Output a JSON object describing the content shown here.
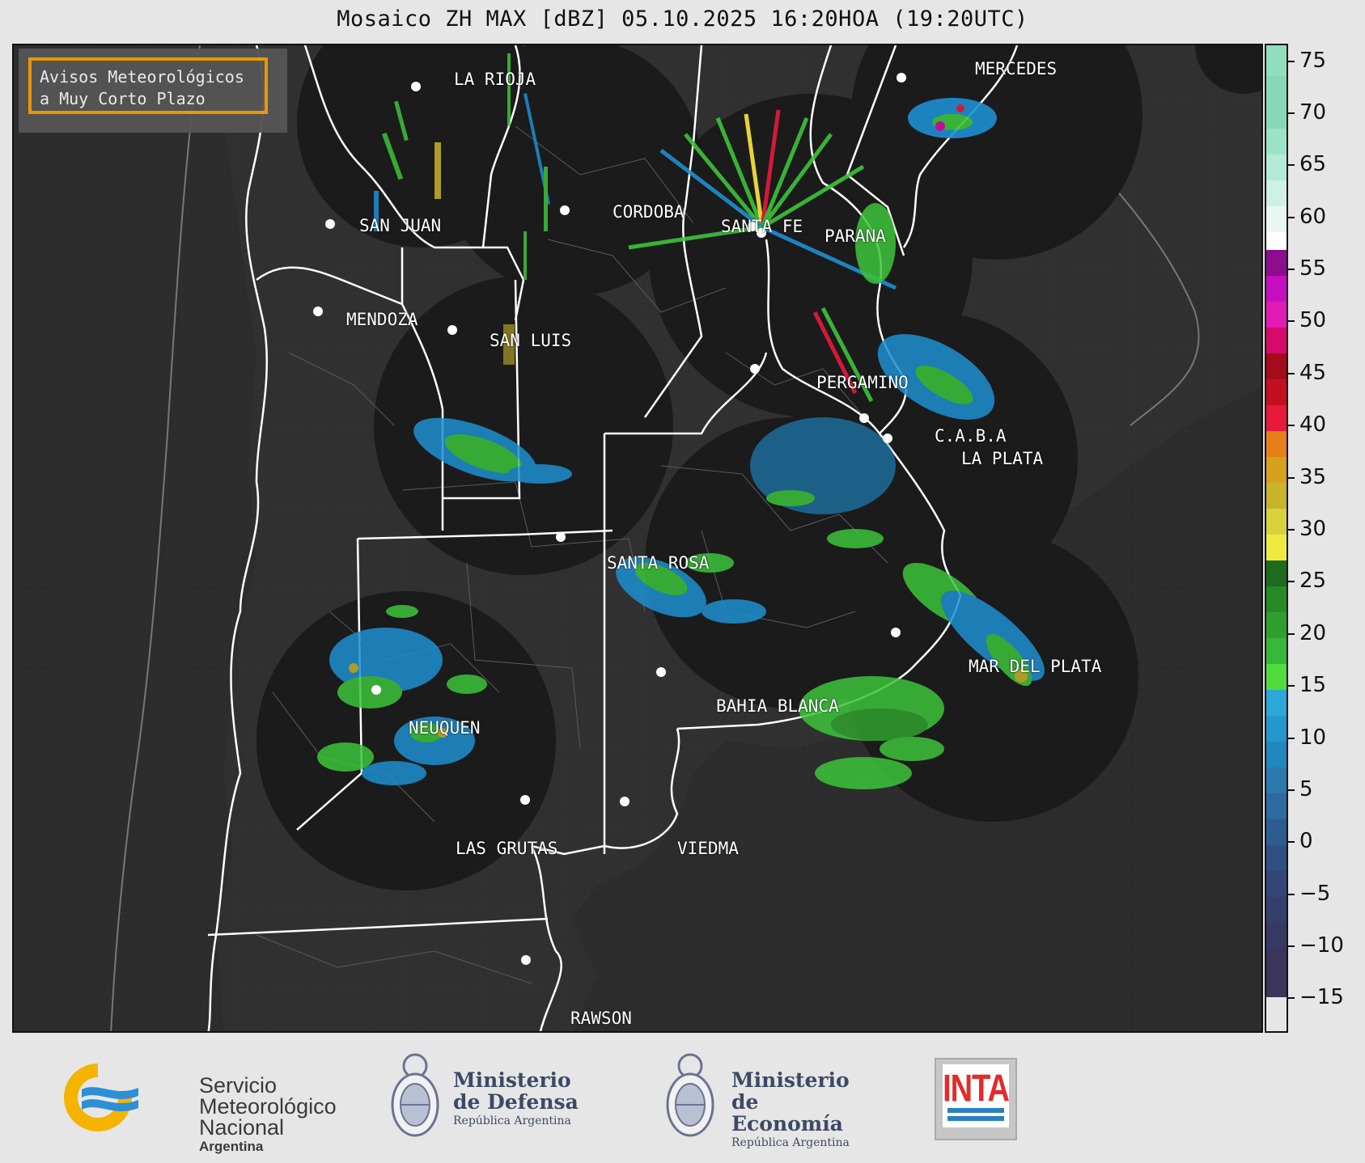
{
  "title": "Mosaico ZH MAX [dBZ] 05.10.2025 16:20HOA (19:20UTC)",
  "badge": {
    "line1": "Avisos Meteorológicos",
    "line2": "a Muy Corto Plazo"
  },
  "cities": [
    {
      "name": "LA RIOJA"
    },
    {
      "name": "MERCEDES"
    },
    {
      "name": "SAN JUAN"
    },
    {
      "name": "CORDOBA"
    },
    {
      "name": "SANTA FE"
    },
    {
      "name": "PARANA"
    },
    {
      "name": "MENDOZA"
    },
    {
      "name": "SAN LUIS"
    },
    {
      "name": "PERGAMINO"
    },
    {
      "name": "C.A.B.A"
    },
    {
      "name": "LA PLATA"
    },
    {
      "name": "SANTA ROSA"
    },
    {
      "name": "MAR DEL PLATA"
    },
    {
      "name": "BAHIA BLANCA"
    },
    {
      "name": "NEUQUEN"
    },
    {
      "name": "LAS GRUTAS"
    },
    {
      "name": "VIEDMA"
    },
    {
      "name": "RAWSON"
    }
  ],
  "colorbar": {
    "ticks": [
      "75",
      "70",
      "65",
      "60",
      "55",
      "50",
      "45",
      "40",
      "35",
      "30",
      "25",
      "20",
      "15",
      "10",
      "5",
      "0",
      "−5",
      "−10",
      "−15"
    ],
    "colors": {
      "land": "#2f2f2f",
      "radar_coverage": "#1b1b1b",
      "province_border": "#ffffff",
      "accent_badge": "#f29c00"
    }
  },
  "logos": {
    "smn": {
      "line1": "Servicio",
      "line2": "Meteorológico",
      "line3": "Nacional",
      "line4": "Argentina"
    },
    "defensa": {
      "line1": "Ministerio",
      "line2": "de Defensa",
      "line3": "República Argentina"
    },
    "economia": {
      "line1": "Ministerio",
      "line2": "de Economía",
      "line3": "República Argentina"
    },
    "inta": {
      "label": "INTA"
    }
  }
}
